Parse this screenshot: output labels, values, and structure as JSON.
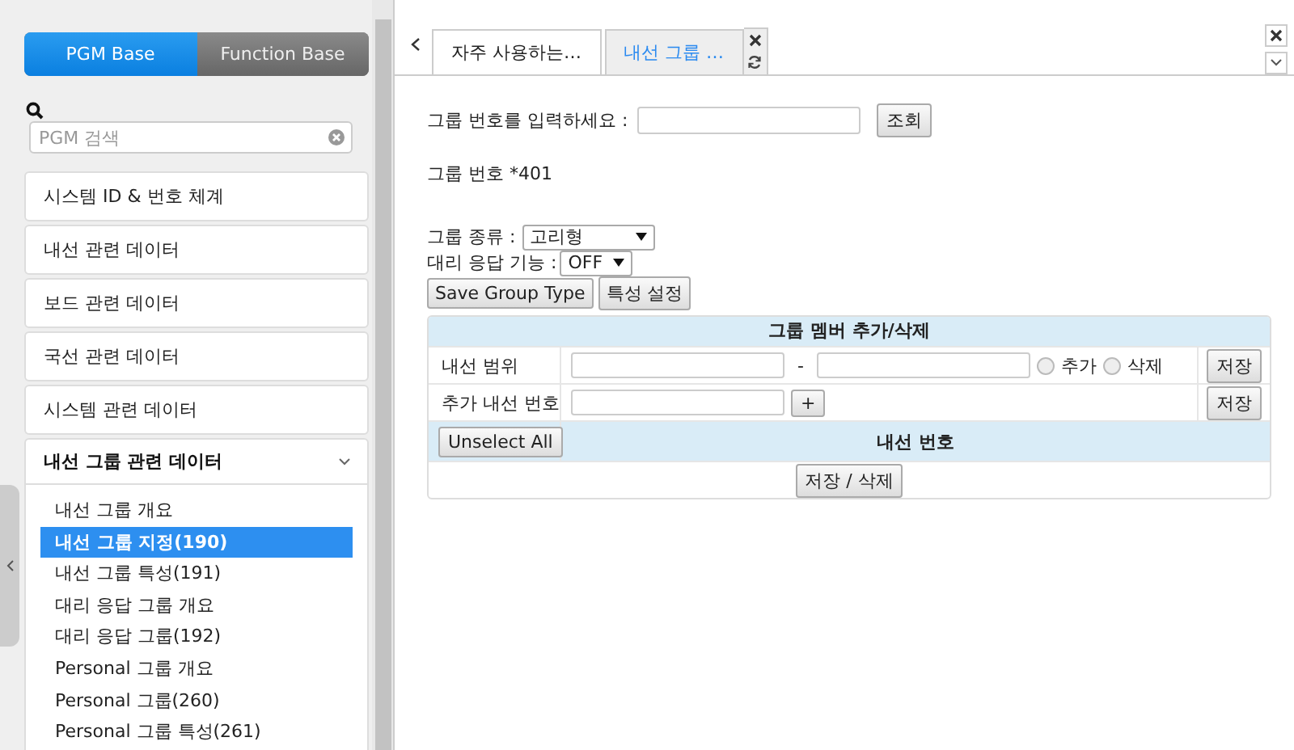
{
  "mode_toggle": [
    {
      "label": "PGM Base",
      "selected": true
    },
    {
      "label": "Function Base",
      "selected": false
    }
  ],
  "search": {
    "placeholder": "PGM 검색"
  },
  "menu": [
    {
      "label": "시스템 ID & 번호 체계",
      "expanded": false
    },
    {
      "label": "내선 관련 데이터",
      "expanded": false
    },
    {
      "label": "보드 관련 데이터",
      "expanded": false
    },
    {
      "label": "국선 관련 데이터",
      "expanded": false
    },
    {
      "label": "시스템 관련 데이터",
      "expanded": false
    },
    {
      "label": "내선 그룹 관련 데이터",
      "expanded": true,
      "children": [
        {
          "label": "내선 그룹 개요",
          "selected": false
        },
        {
          "label": "내선 그룹 지정(190)",
          "selected": true
        },
        {
          "label": "내선 그룹 특성(191)",
          "selected": false
        },
        {
          "label": "대리 응답 그룹 개요",
          "selected": false
        },
        {
          "label": "대리 응답 그룹(192)",
          "selected": false
        },
        {
          "label": "Personal 그룹 개요",
          "selected": false
        },
        {
          "label": "Personal 그룹(260)",
          "selected": false
        },
        {
          "label": "Personal 그룹 특성(261)",
          "selected": false
        }
      ]
    }
  ],
  "tabs": [
    {
      "label": "자주 사용하는…",
      "selected": false
    },
    {
      "label": "내선 그룹 …",
      "selected": true
    }
  ],
  "lookup": {
    "label": "그룹 번호를 입력하세요 :",
    "button": "조회"
  },
  "group_number": "그룹 번호 *401",
  "group_type": {
    "label": "그룹 종류 :",
    "value": "고리형"
  },
  "pickup": {
    "label": "대리 응답 기능 :",
    "value": "OFF"
  },
  "buttons": [
    "Save Group Type",
    "특성 설정"
  ],
  "member_table": {
    "title": "그룹 멤버 추가/삭제",
    "range": {
      "label": "내선 범위",
      "separator": "-",
      "options": [
        {
          "label": "추가",
          "selected": false
        },
        {
          "label": "삭제",
          "selected": false
        }
      ],
      "button": "저장"
    },
    "add": {
      "label": "추가 내선 번호",
      "plus": "+",
      "button": "저장"
    },
    "unselect": "Unselect All",
    "column": "내선 번호",
    "save_delete": "저장 / 삭제"
  }
}
